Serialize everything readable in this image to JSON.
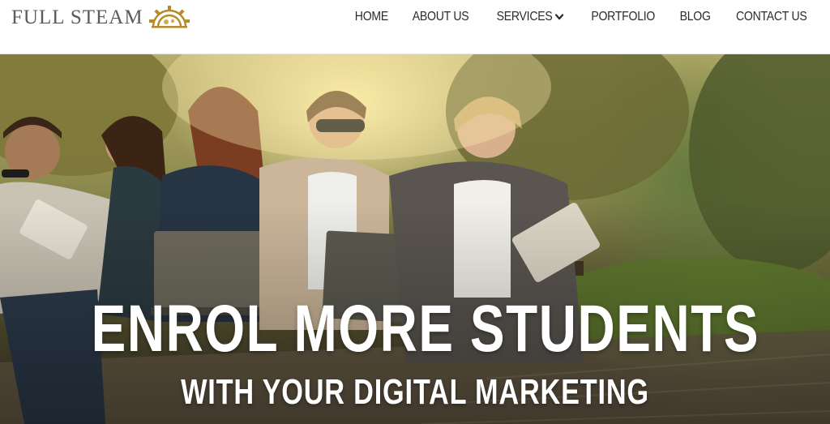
{
  "brand": {
    "name": "FULL STEAM",
    "logo_icon": "gear-icon",
    "logo_color": "#b78a2c"
  },
  "nav": {
    "items": [
      {
        "label": "HOME"
      },
      {
        "label": "ABOUT US"
      },
      {
        "label": "SERVICES",
        "icon": "chevron-down-icon"
      },
      {
        "label": "PORTFOLIO"
      },
      {
        "label": "BLOG"
      },
      {
        "label": "CONTACT US"
      }
    ]
  },
  "hero": {
    "title": "ENROL MORE STUDENTS",
    "subtitle": "WITH YOUR DIGITAL MARKETING",
    "image_alt": "students-with-laptops-photo"
  },
  "colors": {
    "text_dark": "#2b2b2b",
    "logo_grey": "#5b5b5b",
    "hero_text": "#ffffff"
  }
}
